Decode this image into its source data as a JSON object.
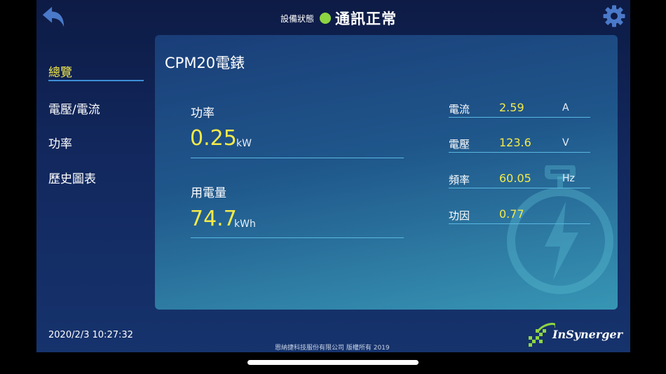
{
  "header": {
    "status_label": "設備狀態",
    "status_text": "通訊正常",
    "status_color": "#8ed542"
  },
  "icons": {
    "back": "back-arrow-icon",
    "settings": "gear-icon",
    "watermark": "power-bolt-icon"
  },
  "sidebar": {
    "items": [
      {
        "label": "總覽",
        "active": true
      },
      {
        "label": "電壓/電流",
        "active": false
      },
      {
        "label": "功率",
        "active": false
      },
      {
        "label": "歷史圖表",
        "active": false
      }
    ]
  },
  "panel": {
    "title": "CPM20電錶",
    "power": {
      "label": "功率",
      "value": "0.25",
      "unit": "kW"
    },
    "energy": {
      "label": "用電量",
      "value": "74.7",
      "unit": "kWh"
    },
    "readings": [
      {
        "label": "電流",
        "value": "2.59",
        "unit": "A"
      },
      {
        "label": "電壓",
        "value": "123.6",
        "unit": "V"
      },
      {
        "label": "頻率",
        "value": "60.05",
        "unit": "Hz"
      },
      {
        "label": "功因",
        "value": "0.77",
        "unit": ""
      }
    ]
  },
  "footer": {
    "datetime": "2020/2/3 10:27:32",
    "copyright": "恩納捷科技服份有限公司 版權所有 2019",
    "logo_text": "InSynerger"
  },
  "colors": {
    "accent_yellow": "#f4ea4a",
    "line_blue": "#5ab8e0"
  }
}
